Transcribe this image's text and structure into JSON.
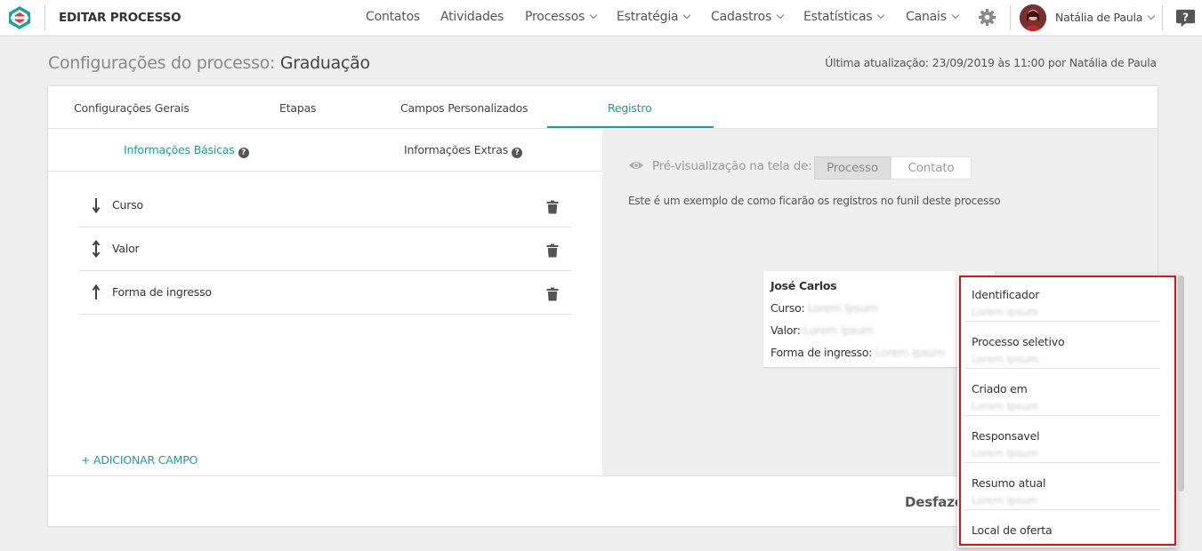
{
  "app": {
    "section_title": "EDITAR PROCESSO",
    "nav": [
      {
        "label": "Contatos",
        "has_caret": false
      },
      {
        "label": "Atividades",
        "has_caret": false
      },
      {
        "label": "Processos",
        "has_caret": true
      },
      {
        "label": "Estratégia",
        "has_caret": true
      },
      {
        "label": "Cadastros",
        "has_caret": true
      },
      {
        "label": "Estatísticas",
        "has_caret": true
      },
      {
        "label": "Canais",
        "has_caret": true
      }
    ],
    "settings_icon": "gear-icon",
    "user_name": "Natália de Paula",
    "help_icon": "help-icon"
  },
  "header": {
    "title_prefix": "Configurações do processo: ",
    "title_name": "Graduação",
    "last_update": "Última atualização: 23/09/2019 às 11:00 por Natália de Paula"
  },
  "tabs": [
    {
      "label": "Configurações Gerais",
      "active": false
    },
    {
      "label": "Etapas",
      "active": false
    },
    {
      "label": "Campos Personalizados",
      "active": false
    },
    {
      "label": "Registro",
      "active": true
    }
  ],
  "subtabs": [
    {
      "label": "Informações Básicas",
      "active": true
    },
    {
      "label": "Informações Extras",
      "active": false
    }
  ],
  "fields": [
    {
      "label": "Curso",
      "arrow": "down"
    },
    {
      "label": "Valor",
      "arrow": "updown"
    },
    {
      "label": "Forma de ingresso",
      "arrow": "up"
    }
  ],
  "add_field": "+ ADICIONAR CAMPO",
  "preview": {
    "label": "Pré-visualização na tela de:",
    "options": [
      "Processo",
      "Contato"
    ],
    "selected": "Processo",
    "description": "Este é um exemplo de como ficarão os registros no funil deste processo"
  },
  "card": {
    "name": "José Carlos",
    "lines": [
      {
        "label": "Curso:",
        "value": "Lorem Ipsum"
      },
      {
        "label": "Valor:",
        "value": "Lorem Ipsum"
      },
      {
        "label": "Forma de ingresso:",
        "value": "Lorem Ipsum"
      }
    ]
  },
  "undo_label": "Desfazer",
  "dropdown": {
    "items": [
      {
        "label": "Identificador",
        "sub": "Lorem Ipsum"
      },
      {
        "label": "Processo seletivo",
        "sub": "Lorem Ipsum"
      },
      {
        "label": "Criado em",
        "sub": "Lorem Ipsum"
      },
      {
        "label": "Responsavel",
        "sub": "Lorem Ipsum"
      },
      {
        "label": "Resumo atual",
        "sub": "Lorem Ipsum"
      },
      {
        "label": "Local de oferta",
        "sub": ""
      }
    ],
    "highlight_color": "#e01010"
  },
  "colors": {
    "accent": "#1e9c9c",
    "brand": "#1aa39b"
  }
}
